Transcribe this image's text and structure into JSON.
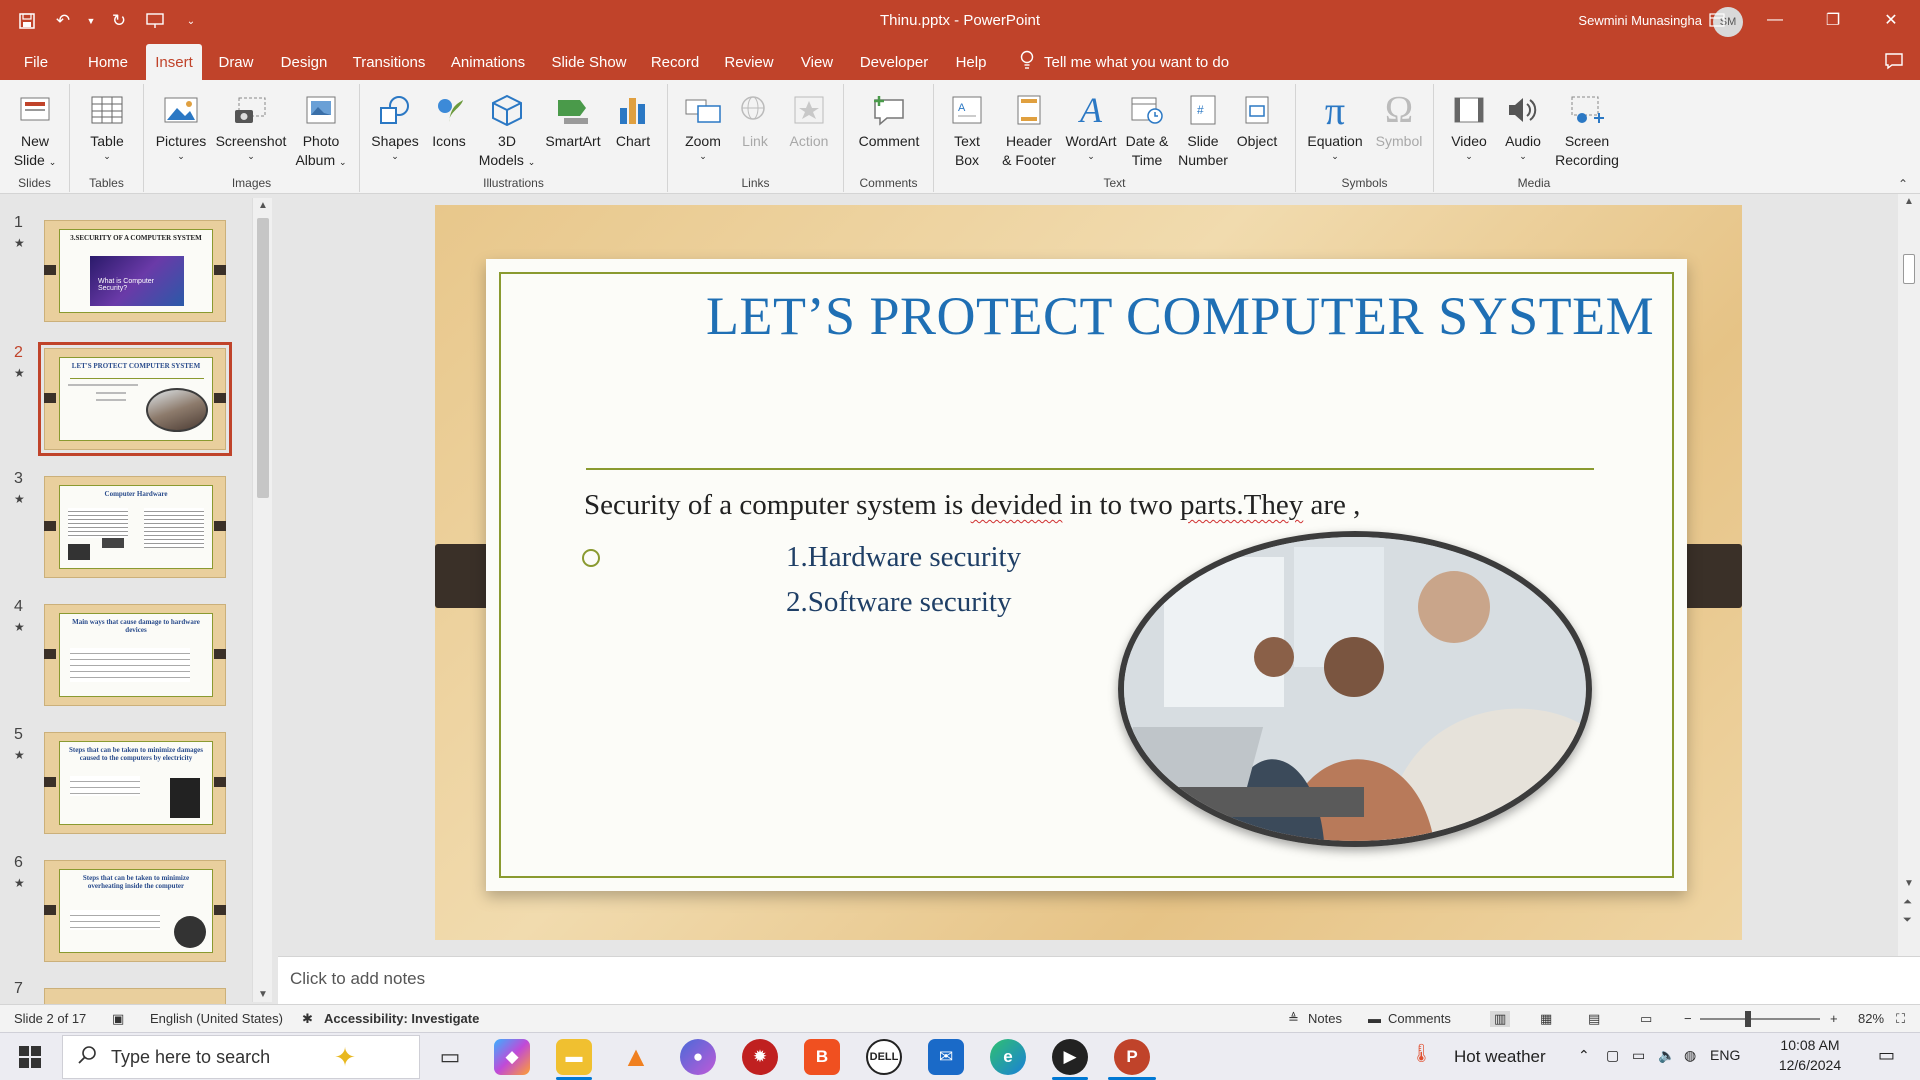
{
  "window": {
    "title": "Thinu.pptx  -  PowerPoint",
    "user_name": "Sewmini Munasingha",
    "user_initials": "SM"
  },
  "tabs": [
    "File",
    "Home",
    "Insert",
    "Draw",
    "Design",
    "Transitions",
    "Animations",
    "Slide Show",
    "Record",
    "Review",
    "View",
    "Developer",
    "Help"
  ],
  "active_tab": "Insert",
  "tell_me": "Tell me what you want to do",
  "ribbon": {
    "groups": [
      "Slides",
      "Tables",
      "Images",
      "Illustrations",
      "Links",
      "Comments",
      "Text",
      "Symbols",
      "Media"
    ],
    "buttons": {
      "new_slide": [
        "New",
        "Slide"
      ],
      "table": "Table",
      "pictures": "Pictures",
      "screenshot": "Screenshot",
      "photo_album": [
        "Photo",
        "Album"
      ],
      "shapes": "Shapes",
      "icons": "Icons",
      "models_3d": [
        "3D",
        "Models"
      ],
      "smartart": "SmartArt",
      "chart": "Chart",
      "zoom": "Zoom",
      "link": "Link",
      "action": "Action",
      "comment": "Comment",
      "text_box": [
        "Text",
        "Box"
      ],
      "header_footer": [
        "Header",
        "& Footer"
      ],
      "wordart": "WordArt",
      "date_time": [
        "Date &",
        "Time"
      ],
      "slide_number": [
        "Slide",
        "Number"
      ],
      "object": "Object",
      "equation": "Equation",
      "symbol": "Symbol",
      "video": "Video",
      "audio": "Audio",
      "screen_recording": [
        "Screen",
        "Recording"
      ]
    }
  },
  "thumbnails": [
    {
      "num": "1",
      "title": "3.SECURITY OF A COMPUTER SYSTEM",
      "caption": "What is Computer Security?"
    },
    {
      "num": "2",
      "title": "LET'S PROTECT COMPUTER SYSTEM"
    },
    {
      "num": "3",
      "title": "Computer Hardware"
    },
    {
      "num": "4",
      "title": "Main ways that cause damage to hardware devices"
    },
    {
      "num": "5",
      "title": "Steps that can be taken to minimize damages caused to the computers by electricity"
    },
    {
      "num": "6",
      "title": "Steps that can be taken to minimize overheating inside the computer"
    },
    {
      "num": "7",
      "title": ""
    }
  ],
  "slide": {
    "title": "LET’S PROTECT COMPUTER SYSTEM",
    "body_parts": [
      "Security of  a computer system is ",
      "devided",
      " in to two ",
      "parts.They",
      " are ,"
    ],
    "points": [
      "1.Hardware security",
      "2.Software security"
    ]
  },
  "notes_placeholder": "Click to add notes",
  "status": {
    "slide_counter": "Slide 2 of 17",
    "language": "English (United States)",
    "accessibility": "Accessibility: Investigate",
    "notes": "Notes",
    "comments": "Comments",
    "zoom": "82%"
  },
  "taskbar": {
    "search_placeholder": "Type here to search",
    "weather": "Hot weather",
    "lang": "ENG",
    "time": "10:08 AM",
    "date": "12/6/2024"
  },
  "colors": {
    "accent": "#c0432a",
    "title_blue": "#1f6fb4",
    "frame_green": "#8a9a30"
  }
}
